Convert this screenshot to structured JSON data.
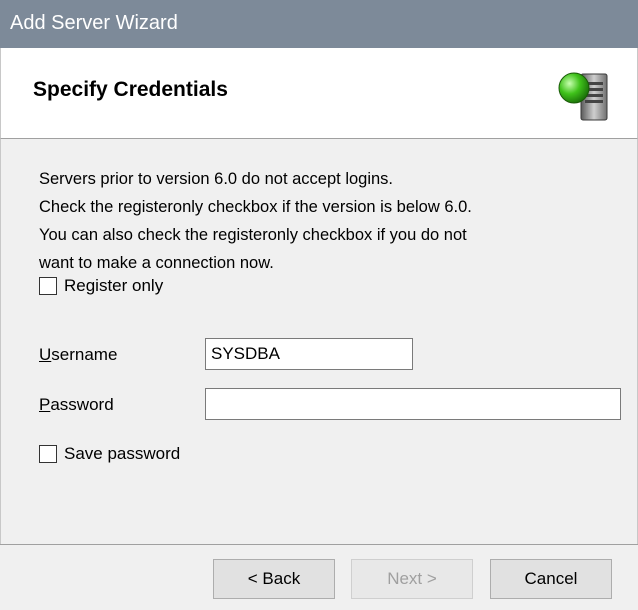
{
  "window": {
    "title": "Add Server Wizard"
  },
  "header": {
    "title": "Specify Credentials",
    "icon": "server-icon"
  },
  "description": [
    "Servers prior to version 6.0 do not accept logins.",
    "Check the registeronly checkbox if the version is below 6.0.",
    "You can also check the registeronly checkbox if you do not",
    "want to make a connection now."
  ],
  "register_only": {
    "label": "Register only",
    "checked": false
  },
  "username": {
    "label_first": "U",
    "label_rest": "sername",
    "value": "SYSDBA"
  },
  "password": {
    "label_first": "P",
    "label_rest": "assword",
    "value": ""
  },
  "save_password": {
    "label": "Save password",
    "checked": false
  },
  "buttons": {
    "back": "< Back",
    "next": "Next >",
    "cancel": "Cancel"
  },
  "colors": {
    "titlebar": "#7d8a99",
    "header_bg": "#ffffff",
    "body_bg": "#f0f0f0"
  }
}
